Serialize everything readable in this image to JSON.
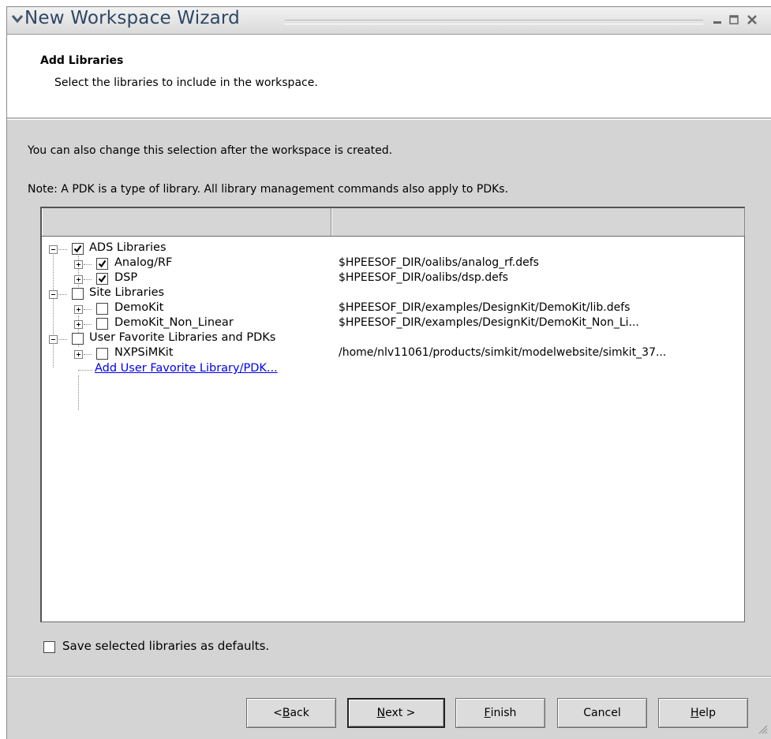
{
  "window": {
    "title": "New Workspace Wizard"
  },
  "header": {
    "title": "Add Libraries",
    "subtitle": "Select the libraries to include in the workspace."
  },
  "info": {
    "line1": "You can also change this selection after the workspace is created.",
    "line2": "Note: A PDK is a type of library. All library management commands also apply to PDKs."
  },
  "table": {
    "columns": [
      "",
      ""
    ],
    "rows": [
      {
        "label": "ADS Libraries",
        "path": "",
        "checked": true,
        "level": 0
      },
      {
        "label": "Analog/RF",
        "path": "$HPEESOF_DIR/oalibs/analog_rf.defs",
        "checked": true,
        "level": 1
      },
      {
        "label": "DSP",
        "path": "$HPEESOF_DIR/oalibs/dsp.defs",
        "checked": true,
        "level": 1
      },
      {
        "label": "Site Libraries",
        "path": "",
        "checked": false,
        "level": 0
      },
      {
        "label": "DemoKit",
        "path": "$HPEESOF_DIR/examples/DesignKit/DemoKit/lib.defs",
        "checked": false,
        "level": 1
      },
      {
        "label": "DemoKit_Non_Linear",
        "path": "$HPEESOF_DIR/examples/DesignKit/DemoKit_Non_Li...",
        "checked": false,
        "level": 1
      },
      {
        "label": "User Favorite Libraries and PDKs",
        "path": "",
        "checked": false,
        "level": 0
      },
      {
        "label": "NXPSiMKit",
        "path": "/home/nlv11061/products/simkit/modelwebsite/simkit_37...",
        "checked": false,
        "level": 1
      }
    ],
    "add_link": "Add User Favorite Library/PDK..."
  },
  "save_defaults": {
    "label": "Save selected libraries as defaults.",
    "checked": false
  },
  "buttons": {
    "back": {
      "pre": "< ",
      "mnemonic": "B",
      "post": "ack"
    },
    "next": {
      "pre": "",
      "mnemonic": "N",
      "post": "ext >"
    },
    "finish": {
      "pre": "",
      "mnemonic": "F",
      "post": "inish"
    },
    "cancel": {
      "pre": "",
      "mnemonic": "",
      "post": "Cancel"
    },
    "help": {
      "pre": "",
      "mnemonic": "H",
      "post": "elp"
    }
  }
}
